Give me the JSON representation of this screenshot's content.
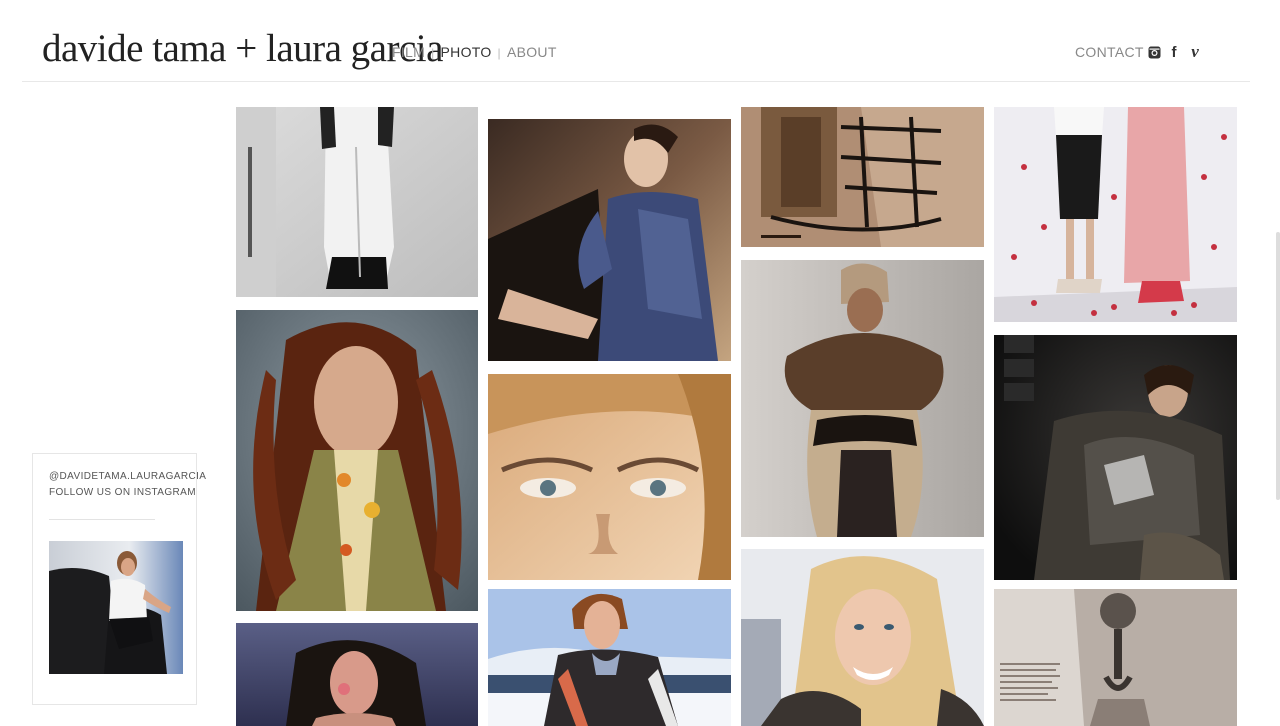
{
  "site": {
    "logo": "davide tama + laura garcia"
  },
  "nav": {
    "items": [
      {
        "label": "FILM",
        "active": false
      },
      {
        "label": "PHOTO",
        "active": true
      },
      {
        "label": "ABOUT",
        "active": false
      }
    ],
    "separator": "|",
    "contact": "CONTACT"
  },
  "social": {
    "icons": [
      "instagram-icon",
      "facebook-icon",
      "vimeo-icon"
    ],
    "facebook_glyph": "f",
    "vimeo_glyph": "v"
  },
  "instagram_widget": {
    "handle": "@DAVIDETAMA.LAURAGARCIA",
    "follow_text": "FOLLOW US ON INSTAGRAM"
  },
  "gallery": {
    "photos": [
      {
        "name": "photo-bw-robe"
      },
      {
        "name": "photo-red-hair-man"
      },
      {
        "name": "photo-dark-hair-woman"
      },
      {
        "name": "photo-blue-dress"
      },
      {
        "name": "photo-eyes-closeup"
      },
      {
        "name": "photo-mountain-woman"
      },
      {
        "name": "photo-harness"
      },
      {
        "name": "photo-fur-turban"
      },
      {
        "name": "photo-smiling-blonde"
      },
      {
        "name": "photo-petals-couple"
      },
      {
        "name": "photo-fur-dark"
      },
      {
        "name": "photo-magazine-hook"
      }
    ]
  },
  "colors": {
    "text": "#222222",
    "nav": "#888888",
    "divider": "#e8e8e8"
  }
}
